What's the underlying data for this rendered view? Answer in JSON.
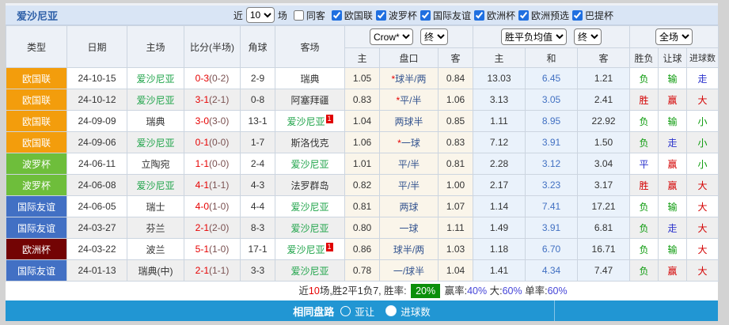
{
  "title": "爱沙尼亚",
  "filterbar": {
    "recent_label": "近",
    "recent_value": "10",
    "matches_label": "场",
    "same_away": {
      "label": "同客",
      "checked": false
    },
    "leagues": [
      {
        "label": "欧国联",
        "checked": true
      },
      {
        "label": "波罗杯",
        "checked": true
      },
      {
        "label": "国际友谊",
        "checked": true
      },
      {
        "label": "欧洲杯",
        "checked": true
      },
      {
        "label": "欧洲预选",
        "checked": true
      },
      {
        "label": "巴提杯",
        "checked": true
      }
    ]
  },
  "controls": {
    "bookmaker": "Crow*",
    "bookmaker_status": "终",
    "avg": "胜平负均值",
    "avg_status": "终",
    "scope": "全场"
  },
  "table": {
    "headers": {
      "type": "类型",
      "date": "日期",
      "home": "主场",
      "score": "比分(半场)",
      "corner": "角球",
      "away": "客场",
      "odds_home": "主",
      "line": "盘口",
      "odds_away": "客",
      "avg_home": "主",
      "avg_draw": "和",
      "avg_away": "客",
      "result": "胜负",
      "handicap_result": "让球",
      "goals": "进球数"
    },
    "league_colors": {
      "欧国联": "#f39d0c",
      "波罗杯": "#6ebe3b",
      "国际友谊": "#4270c4",
      "欧洲杯": "#730404"
    },
    "rows": [
      {
        "league": "欧国联",
        "date": "24-10-15",
        "home": {
          "name": "爱沙尼亚",
          "green": true,
          "sup": ""
        },
        "score": {
          "ft": "0-3",
          "ht": "(0-2)"
        },
        "corner": "2-9",
        "away": {
          "name": "瑞典",
          "green": false,
          "sup": ""
        },
        "crow": {
          "home": "1.05",
          "star": true,
          "line": "球半/两",
          "away": "0.84"
        },
        "avg": {
          "home": "13.03",
          "draw": "6.45",
          "away": "1.21"
        },
        "results": [
          {
            "t": "负",
            "c": "g"
          },
          {
            "t": "输",
            "c": "g"
          },
          {
            "t": "走",
            "c": "b"
          }
        ]
      },
      {
        "league": "欧国联",
        "date": "24-10-12",
        "home": {
          "name": "爱沙尼亚",
          "green": true,
          "sup": ""
        },
        "score": {
          "ft": "3-1",
          "ht": "(2-1)"
        },
        "corner": "0-8",
        "away": {
          "name": "阿塞拜疆",
          "green": false,
          "sup": ""
        },
        "crow": {
          "home": "0.83",
          "star": true,
          "line": "平/半",
          "away": "1.06"
        },
        "avg": {
          "home": "3.13",
          "draw": "3.05",
          "away": "2.41"
        },
        "results": [
          {
            "t": "胜",
            "c": "r"
          },
          {
            "t": "赢",
            "c": "r"
          },
          {
            "t": "大",
            "c": "r"
          }
        ]
      },
      {
        "league": "欧国联",
        "date": "24-09-09",
        "home": {
          "name": "瑞典",
          "green": false,
          "sup": ""
        },
        "score": {
          "ft": "3-0",
          "ht": "(3-0)"
        },
        "corner": "13-1",
        "away": {
          "name": "爱沙尼亚",
          "green": true,
          "sup": "1"
        },
        "crow": {
          "home": "1.04",
          "star": false,
          "line": "两球半",
          "away": "0.85"
        },
        "avg": {
          "home": "1.11",
          "draw": "8.95",
          "away": "22.92"
        },
        "results": [
          {
            "t": "负",
            "c": "g"
          },
          {
            "t": "输",
            "c": "g"
          },
          {
            "t": "小",
            "c": "g"
          }
        ]
      },
      {
        "league": "欧国联",
        "date": "24-09-06",
        "home": {
          "name": "爱沙尼亚",
          "green": true,
          "sup": ""
        },
        "score": {
          "ft": "0-1",
          "ht": "(0-0)"
        },
        "corner": "1-7",
        "away": {
          "name": "斯洛伐克",
          "green": false,
          "sup": ""
        },
        "crow": {
          "home": "1.06",
          "star": true,
          "line": "一球",
          "away": "0.83"
        },
        "avg": {
          "home": "7.12",
          "draw": "3.91",
          "away": "1.50"
        },
        "results": [
          {
            "t": "负",
            "c": "g"
          },
          {
            "t": "走",
            "c": "b"
          },
          {
            "t": "小",
            "c": "g"
          }
        ]
      },
      {
        "league": "波罗杯",
        "date": "24-06-11",
        "home": {
          "name": "立陶宛",
          "green": false,
          "sup": ""
        },
        "score": {
          "ft": "1-1",
          "ht": "(0-0)"
        },
        "corner": "2-4",
        "away": {
          "name": "爱沙尼亚",
          "green": true,
          "sup": ""
        },
        "crow": {
          "home": "1.01",
          "star": false,
          "line": "平/半",
          "away": "0.81"
        },
        "avg": {
          "home": "2.28",
          "draw": "3.12",
          "away": "3.04"
        },
        "results": [
          {
            "t": "平",
            "c": "b"
          },
          {
            "t": "赢",
            "c": "r"
          },
          {
            "t": "小",
            "c": "g"
          }
        ]
      },
      {
        "league": "波罗杯",
        "date": "24-06-08",
        "home": {
          "name": "爱沙尼亚",
          "green": true,
          "sup": ""
        },
        "score": {
          "ft": "4-1",
          "ht": "(1-1)"
        },
        "corner": "4-3",
        "away": {
          "name": "法罗群岛",
          "green": false,
          "sup": ""
        },
        "crow": {
          "home": "0.82",
          "star": false,
          "line": "平/半",
          "away": "1.00"
        },
        "avg": {
          "home": "2.17",
          "draw": "3.23",
          "away": "3.17"
        },
        "results": [
          {
            "t": "胜",
            "c": "r"
          },
          {
            "t": "赢",
            "c": "r"
          },
          {
            "t": "大",
            "c": "r"
          }
        ]
      },
      {
        "league": "国际友谊",
        "date": "24-06-05",
        "home": {
          "name": "瑞士",
          "green": false,
          "sup": ""
        },
        "score": {
          "ft": "4-0",
          "ht": "(1-0)"
        },
        "corner": "4-4",
        "away": {
          "name": "爱沙尼亚",
          "green": true,
          "sup": ""
        },
        "crow": {
          "home": "0.81",
          "star": false,
          "line": "两球",
          "away": "1.07"
        },
        "avg": {
          "home": "1.14",
          "draw": "7.41",
          "away": "17.21"
        },
        "results": [
          {
            "t": "负",
            "c": "g"
          },
          {
            "t": "输",
            "c": "g"
          },
          {
            "t": "大",
            "c": "r"
          }
        ]
      },
      {
        "league": "国际友谊",
        "date": "24-03-27",
        "home": {
          "name": "芬兰",
          "green": false,
          "sup": ""
        },
        "score": {
          "ft": "2-1",
          "ht": "(2-0)"
        },
        "corner": "8-3",
        "away": {
          "name": "爱沙尼亚",
          "green": true,
          "sup": ""
        },
        "crow": {
          "home": "0.80",
          "star": false,
          "line": "一球",
          "away": "1.11"
        },
        "avg": {
          "home": "1.49",
          "draw": "3.91",
          "away": "6.81"
        },
        "results": [
          {
            "t": "负",
            "c": "g"
          },
          {
            "t": "走",
            "c": "b"
          },
          {
            "t": "大",
            "c": "r"
          }
        ]
      },
      {
        "league": "欧洲杯",
        "date": "24-03-22",
        "home": {
          "name": "波兰",
          "green": false,
          "sup": ""
        },
        "score": {
          "ft": "5-1",
          "ht": "(1-0)"
        },
        "corner": "17-1",
        "away": {
          "name": "爱沙尼亚",
          "green": true,
          "sup": "1"
        },
        "crow": {
          "home": "0.86",
          "star": false,
          "line": "球半/两",
          "away": "1.03"
        },
        "avg": {
          "home": "1.18",
          "draw": "6.70",
          "away": "16.71"
        },
        "results": [
          {
            "t": "负",
            "c": "g"
          },
          {
            "t": "输",
            "c": "g"
          },
          {
            "t": "大",
            "c": "r"
          }
        ]
      },
      {
        "league": "国际友谊",
        "date": "24-01-13",
        "home": {
          "name": "瑞典(中)",
          "green": false,
          "sup": ""
        },
        "score": {
          "ft": "2-1",
          "ht": "(1-1)"
        },
        "corner": "3-3",
        "away": {
          "name": "爱沙尼亚",
          "green": true,
          "sup": ""
        },
        "crow": {
          "home": "0.78",
          "star": false,
          "line": "一/球半",
          "away": "1.04"
        },
        "avg": {
          "home": "1.41",
          "draw": "4.34",
          "away": "7.47"
        },
        "results": [
          {
            "t": "负",
            "c": "g"
          },
          {
            "t": "赢",
            "c": "r"
          },
          {
            "t": "大",
            "c": "r"
          }
        ]
      }
    ]
  },
  "summary": {
    "prefix_1": "近",
    "count": "10",
    "prefix_2": "场,胜2平1负7, 胜率:",
    "win_rate": "20%",
    "seg_handicap": "赢率:",
    "handicap_rate": "40%",
    "seg_big": "大:",
    "big_rate": "60%",
    "seg_single": "单率:",
    "single_rate": "60%"
  },
  "bottom": {
    "label": "相同盘路",
    "options": [
      {
        "label": "亚让",
        "selected": false
      },
      {
        "label": "进球数",
        "selected": true
      }
    ]
  },
  "colors": {
    "bar_blue": "#2196d3",
    "title_text_blue": "#2d5fa8",
    "titlebar_bg": "#d9e5f5",
    "score_red": "#e60000",
    "half_score_maroon": "#7a5151",
    "handicap_text_blue": "#34548f",
    "avg_draw_blue": "#4170c2",
    "win_red": "#d40000",
    "lose_green": "#0a9a0a",
    "draw_blue": "#2a32cc",
    "team_green": "#1da348",
    "win_rate_badge_bg": "#0b8f0b",
    "percent_blue": "#4545d8",
    "row_alt_bg": "#efefef",
    "crow_cols_bg": "#faf5ea",
    "avg_cols_bg": "#eaf2fb"
  }
}
